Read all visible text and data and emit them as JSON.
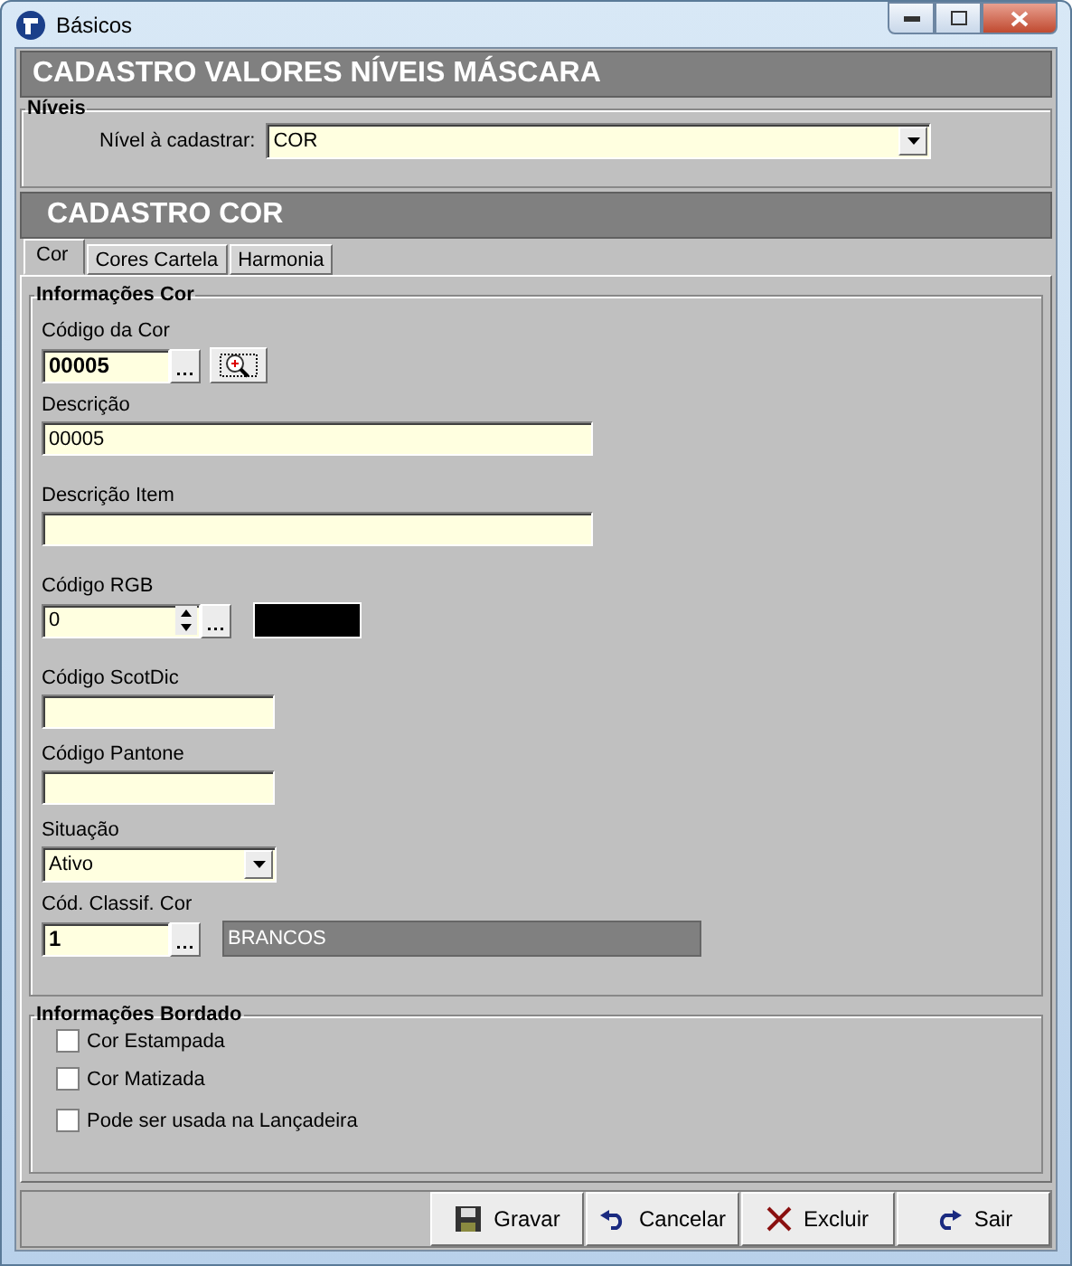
{
  "window": {
    "title": "Básicos"
  },
  "header": "CADASTRO VALORES NÍVEIS MÁSCARA",
  "levels": {
    "legend": "Níveis",
    "label": "Nível à cadastrar:",
    "value": "COR"
  },
  "section_title": "CADASTRO COR",
  "tabs": [
    {
      "label": "Cor",
      "selected": true
    },
    {
      "label": "Cores Cartela",
      "selected": false
    },
    {
      "label": "Harmonia",
      "selected": false
    }
  ],
  "color_info": {
    "legend": "Informações Cor",
    "fields": [
      {
        "kind": "code",
        "label": "Código da Cor",
        "value": "00005"
      },
      {
        "kind": "text",
        "label": "Descrição",
        "value": "00005"
      },
      {
        "kind": "text",
        "label": "Descrição Item"
      },
      {
        "kind": "spin",
        "label": "Código RGB",
        "value": "0"
      },
      {
        "kind": "short",
        "label": "Código ScotDic"
      },
      {
        "kind": "short",
        "label": "Código Pantone"
      },
      {
        "kind": "select",
        "label": "Situação",
        "value": "Ativo"
      },
      {
        "kind": "lookup",
        "label": "Cód. Classif. Cor",
        "value": "1",
        "lookup": "BRANCOS"
      }
    ]
  },
  "embroidery": {
    "legend": "Informações Bordado",
    "options": [
      {
        "label": "Cor Estampada",
        "checked": false
      },
      {
        "label": "Cor Matizada",
        "checked": false
      },
      {
        "label": "Pode ser usada na Lançadeira",
        "checked": false
      }
    ]
  },
  "buttons": [
    {
      "kind": "save",
      "label": "Gravar"
    },
    {
      "kind": "undo",
      "label": "Cancelar"
    },
    {
      "kind": "delete",
      "label": "Excluir"
    },
    {
      "kind": "exit",
      "label": "Sair"
    }
  ]
}
